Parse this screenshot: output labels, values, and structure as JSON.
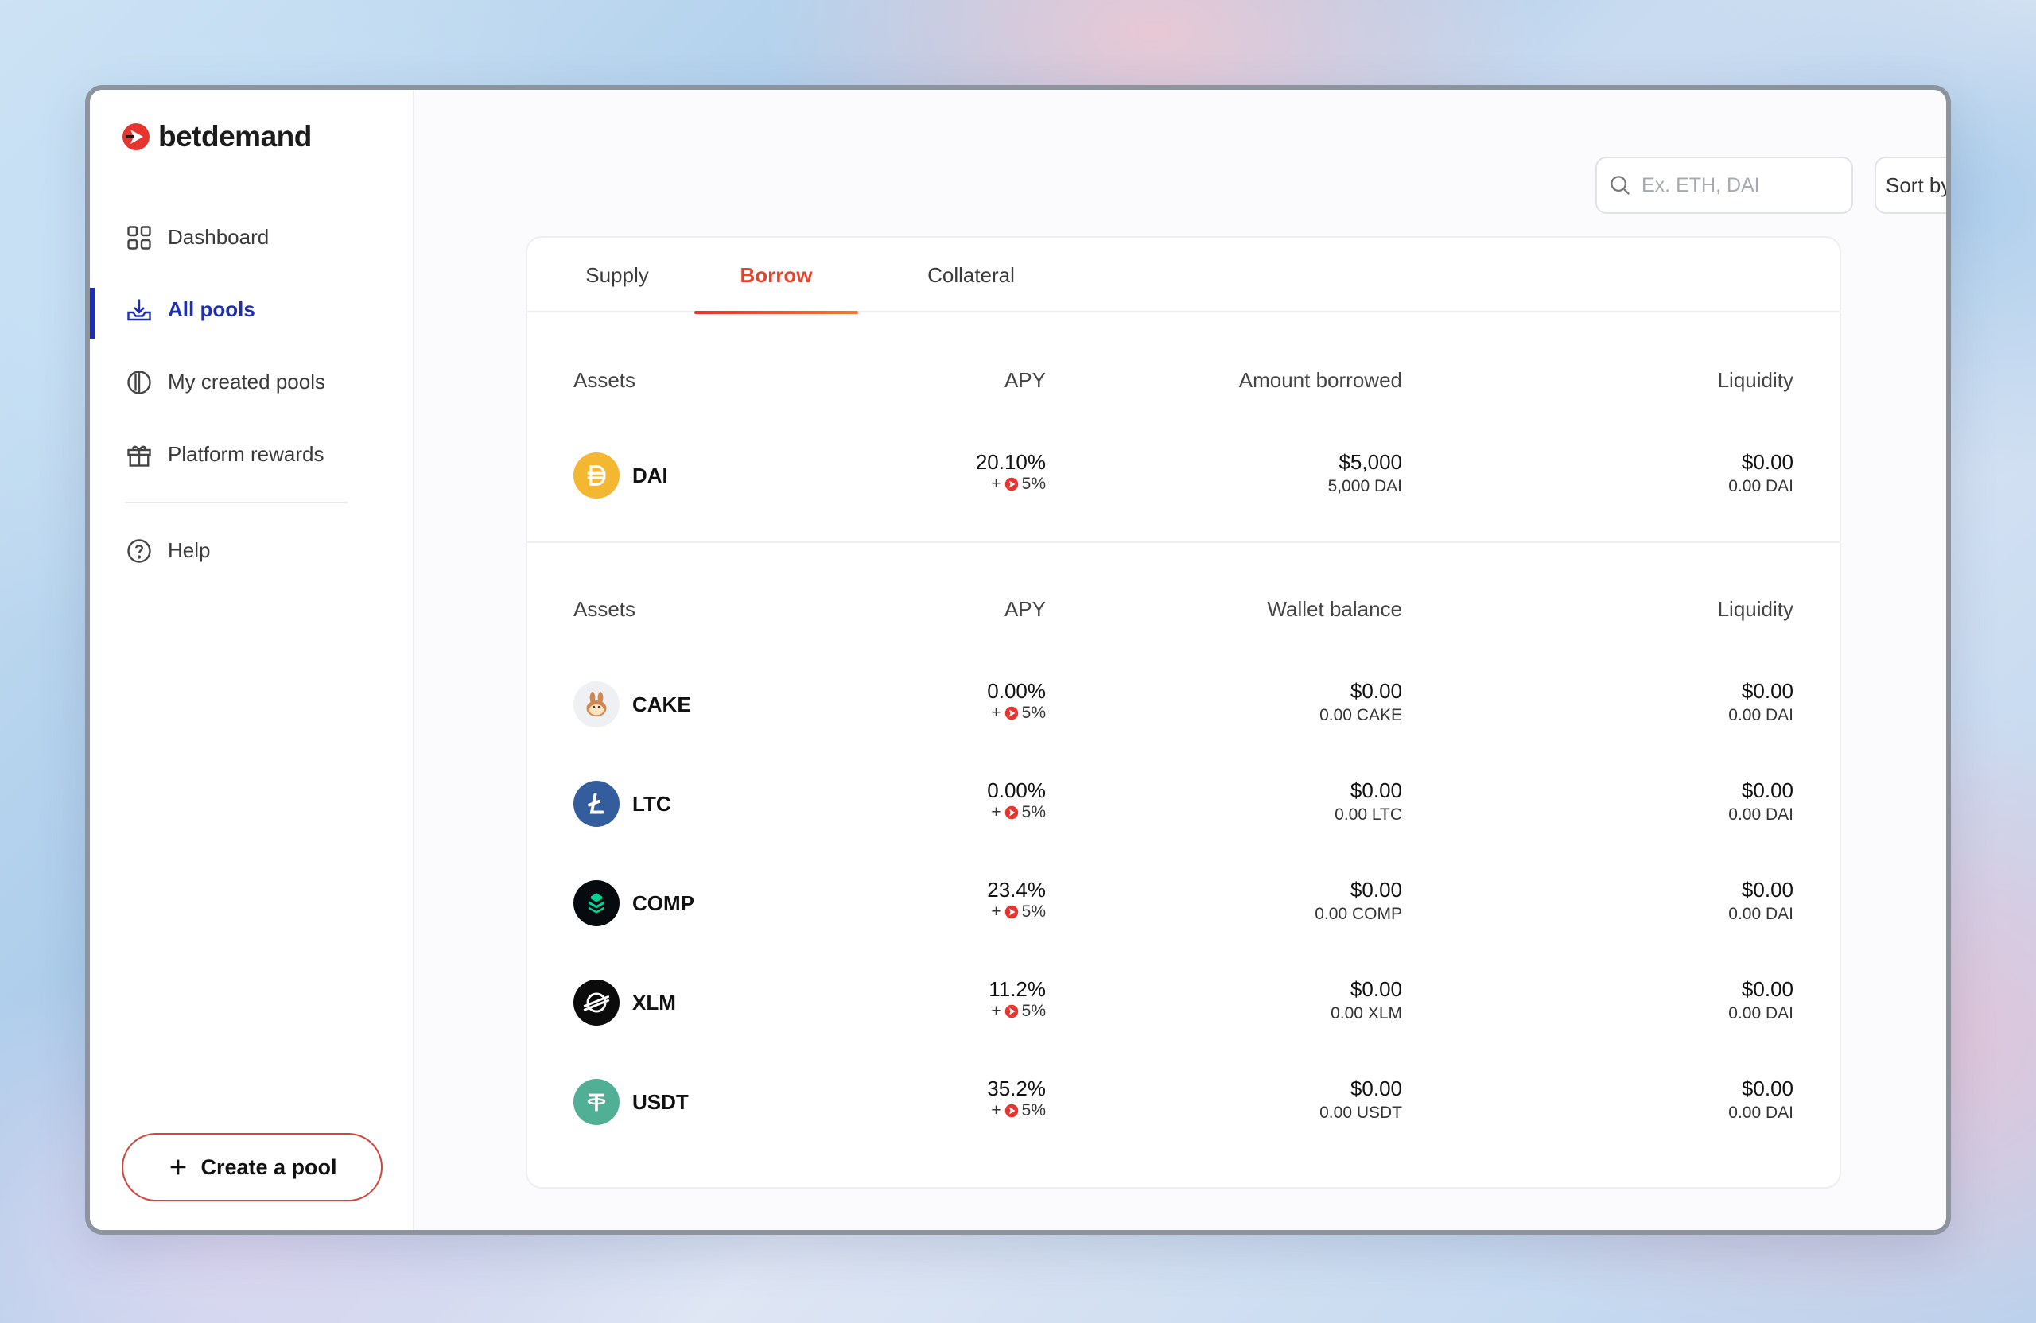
{
  "app": {
    "name": "betdemand"
  },
  "sidebar": {
    "items": [
      {
        "label": "Dashboard",
        "icon": "grid-icon",
        "active": false
      },
      {
        "label": "All pools",
        "icon": "download-tray-icon",
        "active": true
      },
      {
        "label": "My created pools",
        "icon": "half-circle-icon",
        "active": false
      },
      {
        "label": "Platform rewards",
        "icon": "gift-icon",
        "active": false
      }
    ],
    "help_label": "Help",
    "create_label": "Create a pool"
  },
  "toolbar": {
    "search_placeholder": "Ex. ETH, DAI",
    "sort_label": "Sort by:"
  },
  "tabs": [
    {
      "label": "Supply",
      "active": false
    },
    {
      "label": "Borrow",
      "active": true
    },
    {
      "label": "Collateral",
      "active": false
    }
  ],
  "borrowed": {
    "headers": {
      "assets": "Assets",
      "apy": "APY",
      "amount": "Amount borrowed",
      "liquidity": "Liquidity"
    },
    "rows": [
      {
        "symbol": "DAI",
        "apy": "20.10%",
        "reward": "5%",
        "amount": "$5,000",
        "amount_sub": "5,000 DAI",
        "liquidity": "$0.00",
        "liquidity_sub": "0.00 DAI"
      }
    ]
  },
  "available": {
    "headers": {
      "assets": "Assets",
      "apy": "APY",
      "balance": "Wallet balance",
      "liquidity": "Liquidity"
    },
    "rows": [
      {
        "symbol": "CAKE",
        "apy": "0.00%",
        "reward": "5%",
        "balance": "$0.00",
        "balance_sub": "0.00 CAKE",
        "liquidity": "$0.00",
        "liquidity_sub": "0.00 DAI"
      },
      {
        "symbol": "LTC",
        "apy": "0.00%",
        "reward": "5%",
        "balance": "$0.00",
        "balance_sub": "0.00 LTC",
        "liquidity": "$0.00",
        "liquidity_sub": "0.00 DAI"
      },
      {
        "symbol": "COMP",
        "apy": "23.4%",
        "reward": "5%",
        "balance": "$0.00",
        "balance_sub": "0.00 COMP",
        "liquidity": "$0.00",
        "liquidity_sub": "0.00 DAI"
      },
      {
        "symbol": "XLM",
        "apy": "11.2%",
        "reward": "5%",
        "balance": "$0.00",
        "balance_sub": "0.00 XLM",
        "liquidity": "$0.00",
        "liquidity_sub": "0.00 DAI"
      },
      {
        "symbol": "USDT",
        "apy": "35.2%",
        "reward": "5%",
        "balance": "$0.00",
        "balance_sub": "0.00 USDT",
        "liquidity": "$0.00",
        "liquidity_sub": "0.00 DAI"
      }
    ]
  },
  "reward_prefix": "+",
  "colors": {
    "accent": "#e1452e",
    "nav_active": "#1d2fb0",
    "brand": "#e6342f"
  }
}
